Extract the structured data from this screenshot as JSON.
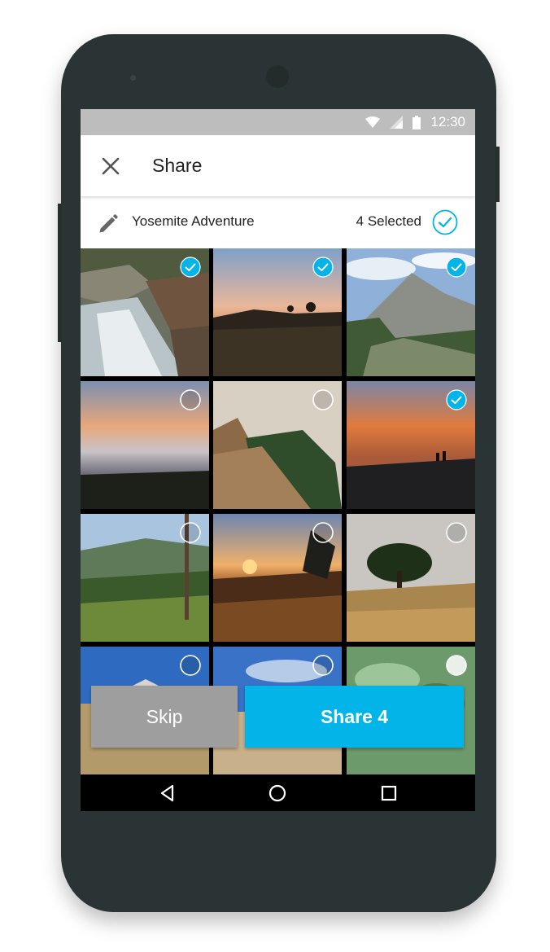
{
  "status_bar": {
    "time": "12:30",
    "icons": [
      "wifi-icon",
      "signal-icon",
      "battery-icon"
    ]
  },
  "app_bar": {
    "title": "Share",
    "close_icon": "close-icon"
  },
  "album": {
    "name": "Yosemite Adventure",
    "selected_label": "4 Selected",
    "icon": "pencil-icon"
  },
  "photos": [
    {
      "subject": "waterfall",
      "selected": true
    },
    {
      "subject": "sunset-hill",
      "selected": true
    },
    {
      "subject": "mountain",
      "selected": true
    },
    {
      "subject": "sea-of-clouds",
      "selected": false
    },
    {
      "subject": "hiker-on-ridge",
      "selected": false
    },
    {
      "subject": "sunset-silhouettes",
      "selected": true
    },
    {
      "subject": "forest-valley",
      "selected": false
    },
    {
      "subject": "sunset-grass",
      "selected": false
    },
    {
      "subject": "lone-tree",
      "selected": false
    },
    {
      "subject": "tent-blue-sky",
      "selected": false
    },
    {
      "subject": "blue-sky-beach",
      "selected": false
    },
    {
      "subject": "green-plant",
      "selected": false
    }
  ],
  "actions": {
    "skip_label": "Skip",
    "share_label": "Share 4"
  },
  "colors": {
    "accent": "#03b4e8",
    "skip": "#9e9e9e",
    "status_bar": "#bdbdbd",
    "phone_body": "#2b3434"
  },
  "nav_bar": {
    "icons": [
      "back-icon",
      "home-icon",
      "recents-icon"
    ]
  }
}
